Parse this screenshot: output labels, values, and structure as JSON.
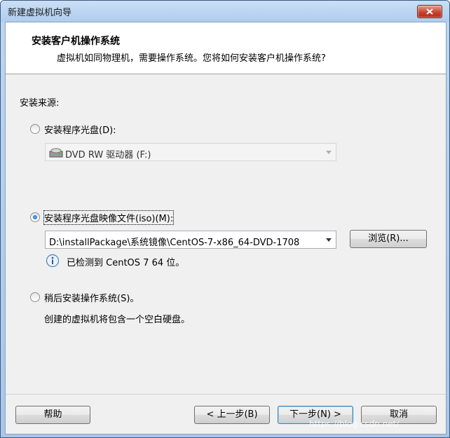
{
  "window": {
    "title": "新建虚拟机向导"
  },
  "header": {
    "title": "安装客户机操作系统",
    "subtitle": "虚拟机如同物理机，需要操作系统。您将如何安装客户机操作系统?"
  },
  "section_label": "安装来源:",
  "options": {
    "disc": {
      "label": "安装程序光盘(D):",
      "selected": false
    },
    "disc_drive": {
      "value": "DVD RW 驱动器 (F:)"
    },
    "iso": {
      "label": "安装程序光盘映像文件(iso)(M):",
      "selected": true
    },
    "iso_path": {
      "value": "D:\\installPackage\\系统镜像\\CentOS-7-x86_64-DVD-1708"
    },
    "browse_label": "浏览(R)...",
    "detected_text": "已检测到 CentOS 7 64 位。",
    "later": {
      "label": "稍后安装操作系统(S)。",
      "selected": false
    },
    "later_desc": "创建的虚拟机将包含一个空白硬盘。"
  },
  "footer": {
    "help": "帮助",
    "back": "< 上一步(B)",
    "next": "下一步(N) >",
    "cancel": "取消"
  },
  "watermark": "https://blog.csdn.net/..."
}
